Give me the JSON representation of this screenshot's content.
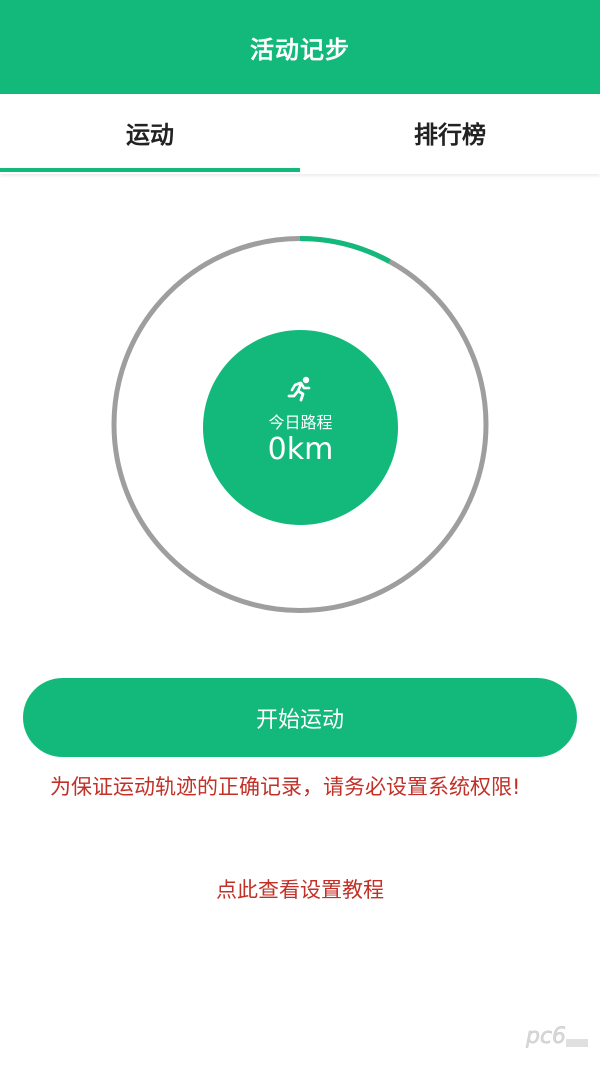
{
  "header": {
    "title": "活动记步"
  },
  "tabs": [
    {
      "label": "运动",
      "active": true
    },
    {
      "label": "排行榜",
      "active": false
    }
  ],
  "progress": {
    "today_label": "今日路程",
    "today_value": "0km",
    "ring_fill_fraction": 0.08,
    "icon": "runner-icon"
  },
  "actions": {
    "start_label": "开始运动",
    "warning": "为保证运动轨迹的正确记录，请务必设置系统权限!",
    "tutorial_link": "点此查看设置教程"
  },
  "watermark": {
    "text": "pc6"
  },
  "colors": {
    "accent": "#13b97b",
    "ring_track": "#9e9e9e",
    "warning": "#c23128"
  }
}
